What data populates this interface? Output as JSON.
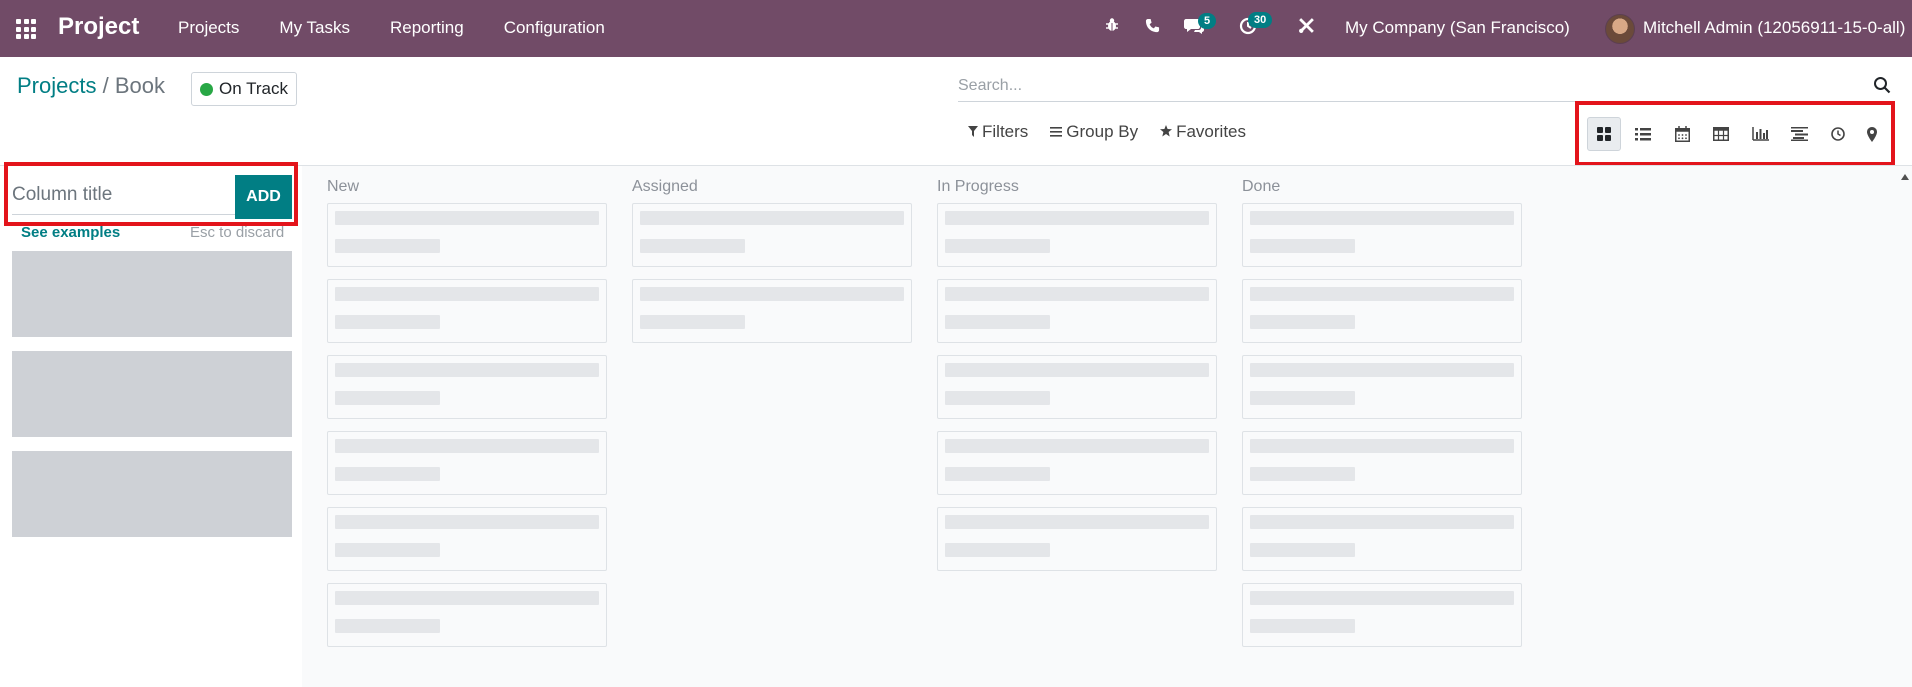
{
  "navbar": {
    "app_name": "Project",
    "menu": [
      "Projects",
      "My Tasks",
      "Reporting",
      "Configuration"
    ],
    "messages_count": "5",
    "activities_count": "30",
    "company": "My Company (San Francisco)",
    "user": "Mitchell Admin (12056911-15-0-all)",
    "bg_color": "#714b67"
  },
  "breadcrumb": {
    "parent": "Projects",
    "separator": "/",
    "current": "Book"
  },
  "status": {
    "label": "On Track",
    "color": "#28a745"
  },
  "search": {
    "placeholder": "Search..."
  },
  "filters": {
    "filters_label": "Filters",
    "group_by_label": "Group By",
    "favorites_label": "Favorites"
  },
  "views": [
    "kanban-icon",
    "list-icon",
    "calendar-icon",
    "pivot-icon",
    "graph-icon",
    "gantt-icon",
    "activity-icon",
    "map-icon"
  ],
  "add_column": {
    "placeholder": "Column title",
    "button_label": "ADD",
    "see_examples": "See examples",
    "esc_discard": "Esc to discard"
  },
  "columns": [
    {
      "title": "New",
      "cards": 6
    },
    {
      "title": "Assigned",
      "cards": 2
    },
    {
      "title": "In Progress",
      "cards": 5
    },
    {
      "title": "Done",
      "cards": 6
    }
  ],
  "accent_color": "#017e84",
  "highlight_color": "#e3141b"
}
